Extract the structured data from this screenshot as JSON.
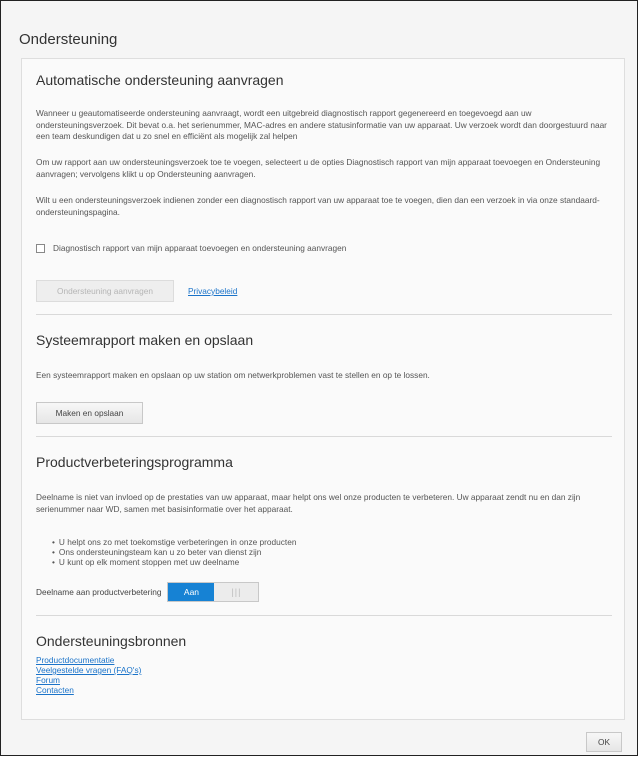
{
  "dialog": {
    "title": "Ondersteuning",
    "ok_label": "OK"
  },
  "auto_support": {
    "title": "Automatische ondersteuning aanvragen",
    "para1": "Wanneer u geautomatiseerde ondersteuning aanvraagt, wordt een uitgebreid diagnostisch rapport gegenereerd en toegevoegd aan uw ondersteuningsverzoek. Dit bevat o.a. het serienummer, MAC-adres en andere statusinformatie van uw apparaat. Uw verzoek wordt dan doorgestuurd naar een team deskundigen dat u zo snel en efficiënt als mogelijk zal helpen",
    "para2": "Om uw rapport aan uw ondersteuningsverzoek toe te voegen, selecteert u de opties Diagnostisch rapport van mijn apparaat toevoegen en Ondersteuning aanvragen; vervolgens klikt u op Ondersteuning aanvragen.",
    "para3": "Wilt u een ondersteuningsverzoek indienen zonder een diagnostisch rapport van uw apparaat toe te voegen, dien dan een verzoek in via onze standaard-ondersteuningspagina.",
    "checkbox_label": "Diagnostisch rapport van mijn apparaat toevoegen en ondersteuning aanvragen",
    "checkbox_checked": false,
    "request_button": "Ondersteuning aanvragen",
    "privacy_link": "Privacybeleid"
  },
  "system_report": {
    "title": "Systeemrapport maken en opslaan",
    "description": "Een systeemrapport maken en opslaan op uw station om netwerkproblemen vast te stellen en op te lossen.",
    "button": "Maken en opslaan"
  },
  "improvement": {
    "title": "Productverbeteringsprogramma",
    "description": "Deelname is niet van invloed op de prestaties van uw apparaat, maar helpt ons wel onze producten te verbeteren. Uw apparaat zendt nu en dan zijn serienummer naar WD, samen met basisinformatie over het apparaat.",
    "bullets": [
      "U helpt ons zo met toekomstige verbeteringen in onze producten",
      "Ons ondersteuningsteam kan u zo beter van dienst zijn",
      "U kunt op elk moment stoppen met uw deelname"
    ],
    "toggle_label": "Deelname aan productverbetering",
    "toggle_on": "Aan",
    "toggle_off": "|||",
    "toggle_state": "on"
  },
  "resources": {
    "title": "Ondersteuningsbronnen",
    "links": [
      "Productdocumentatie",
      "Veelgestelde vragen (FAQ's)",
      "Forum",
      "Contacten"
    ]
  },
  "colors": {
    "accent": "#1682d4",
    "link": "#1a73c9"
  }
}
